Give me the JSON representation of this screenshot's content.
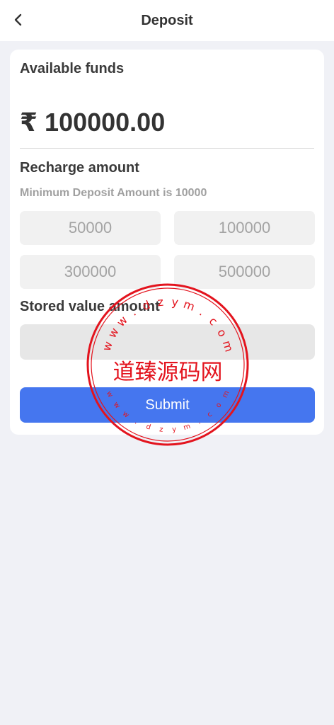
{
  "header": {
    "title": "Deposit"
  },
  "funds": {
    "label": "Available funds",
    "balance": "₹ 100000.00"
  },
  "recharge": {
    "label": "Recharge amount",
    "minimum_note": "Minimum Deposit Amount is 10000",
    "options": [
      "50000",
      "100000",
      "300000",
      "500000"
    ]
  },
  "stored_value": {
    "label": "Stored value amount",
    "value": "",
    "placeholder": ""
  },
  "submit": {
    "label": "Submit"
  },
  "watermark": {
    "center_text": "道臻源码网",
    "ring_text": "www.dzym.com"
  },
  "colors": {
    "accent": "#4576ef",
    "background": "#f0f1f6",
    "stamp": "#e3141e"
  },
  "icons": {
    "back": "chevron-left-icon"
  }
}
